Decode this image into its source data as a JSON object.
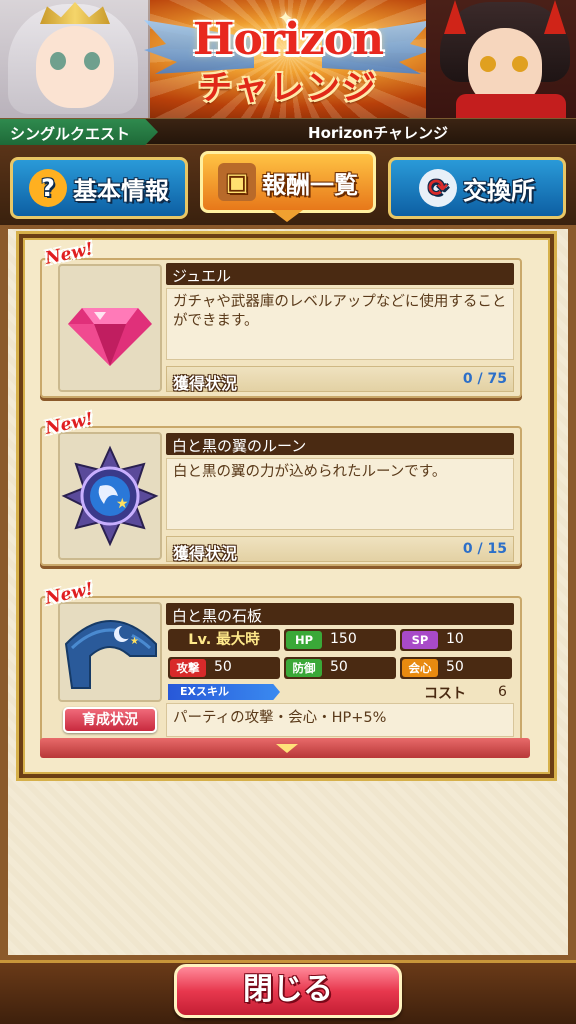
{
  "banner": {
    "title": "Horizon",
    "subtitle": "チャレンジ"
  },
  "breadcrumb": {
    "section": "シングルクエスト",
    "title": "Horizonチャレンジ"
  },
  "tabs": [
    {
      "label": "基本情報",
      "icon": "question-icon",
      "active": false
    },
    {
      "label": "報酬一覧",
      "icon": "treasure-chest-icon",
      "active": true
    },
    {
      "label": "交換所",
      "icon": "exchange-icon",
      "active": false
    }
  ],
  "rewards": [
    {
      "badge": "New!",
      "name": "ジュエル",
      "description": "ガチャや武器庫のレベルアップなどに使用することができます。",
      "progress_label": "獲得状況",
      "progress": "0 / 75",
      "icon": "jewel-icon"
    },
    {
      "badge": "New!",
      "name": "白と黒の翼のルーン",
      "description": "白と黒の翼の力が込められたルーンです。",
      "progress_label": "獲得状況",
      "progress": "0 / 15",
      "icon": "rune-icon"
    },
    {
      "badge": "New!",
      "name": "白と黒の石板",
      "icon": "stone-tablet-icon",
      "level": "Lv. 最大時",
      "stats": {
        "hp_label": "HP",
        "hp": "150",
        "sp_label": "SP",
        "sp": "10",
        "atk_label": "攻撃",
        "atk": "50",
        "def_label": "防御",
        "def": "50",
        "crit_label": "会心",
        "crit": "50"
      },
      "ex_skill_label": "EXスキル",
      "cost_label": "コスト",
      "cost": "6",
      "skill_description": "パーティの攻撃・会心・HP+5%",
      "growth_button": "育成状況"
    }
  ],
  "close_button": "閉じる"
}
